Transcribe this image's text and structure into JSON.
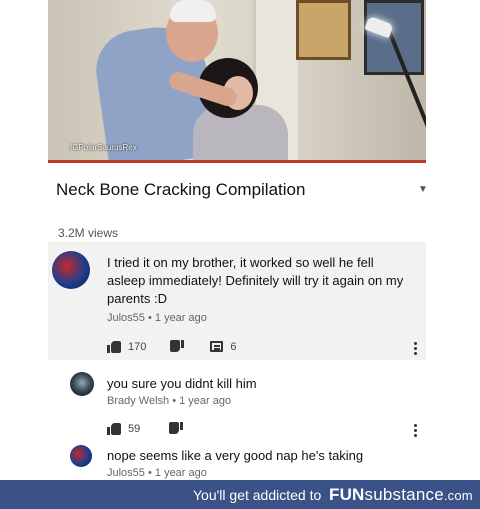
{
  "video": {
    "watermark": "IGPolarSaurusRex"
  },
  "title": "Neck Bone Cracking Compilation",
  "views": "3.2M views",
  "comments": [
    {
      "text_lines": [
        "I tried it on my brother, it worked so well he fell",
        "asleep immediately! Definitely will try it again on my",
        "parents :D"
      ],
      "author": "Julos55",
      "time": "1 year ago",
      "likes": "170",
      "replies": "6"
    },
    {
      "text": "you sure you didnt kill him",
      "author": "Brady Welsh",
      "time": "1 year ago",
      "likes": "59"
    },
    {
      "text": "nope seems like a very good nap he's taking",
      "author": "Julos55",
      "time": "1 year ago"
    }
  ],
  "footer": {
    "text": "You'll get addicted to",
    "logo_a": "FUN",
    "logo_b": "substance",
    "logo_c": ".com",
    "bg_color": "#3a5287"
  }
}
